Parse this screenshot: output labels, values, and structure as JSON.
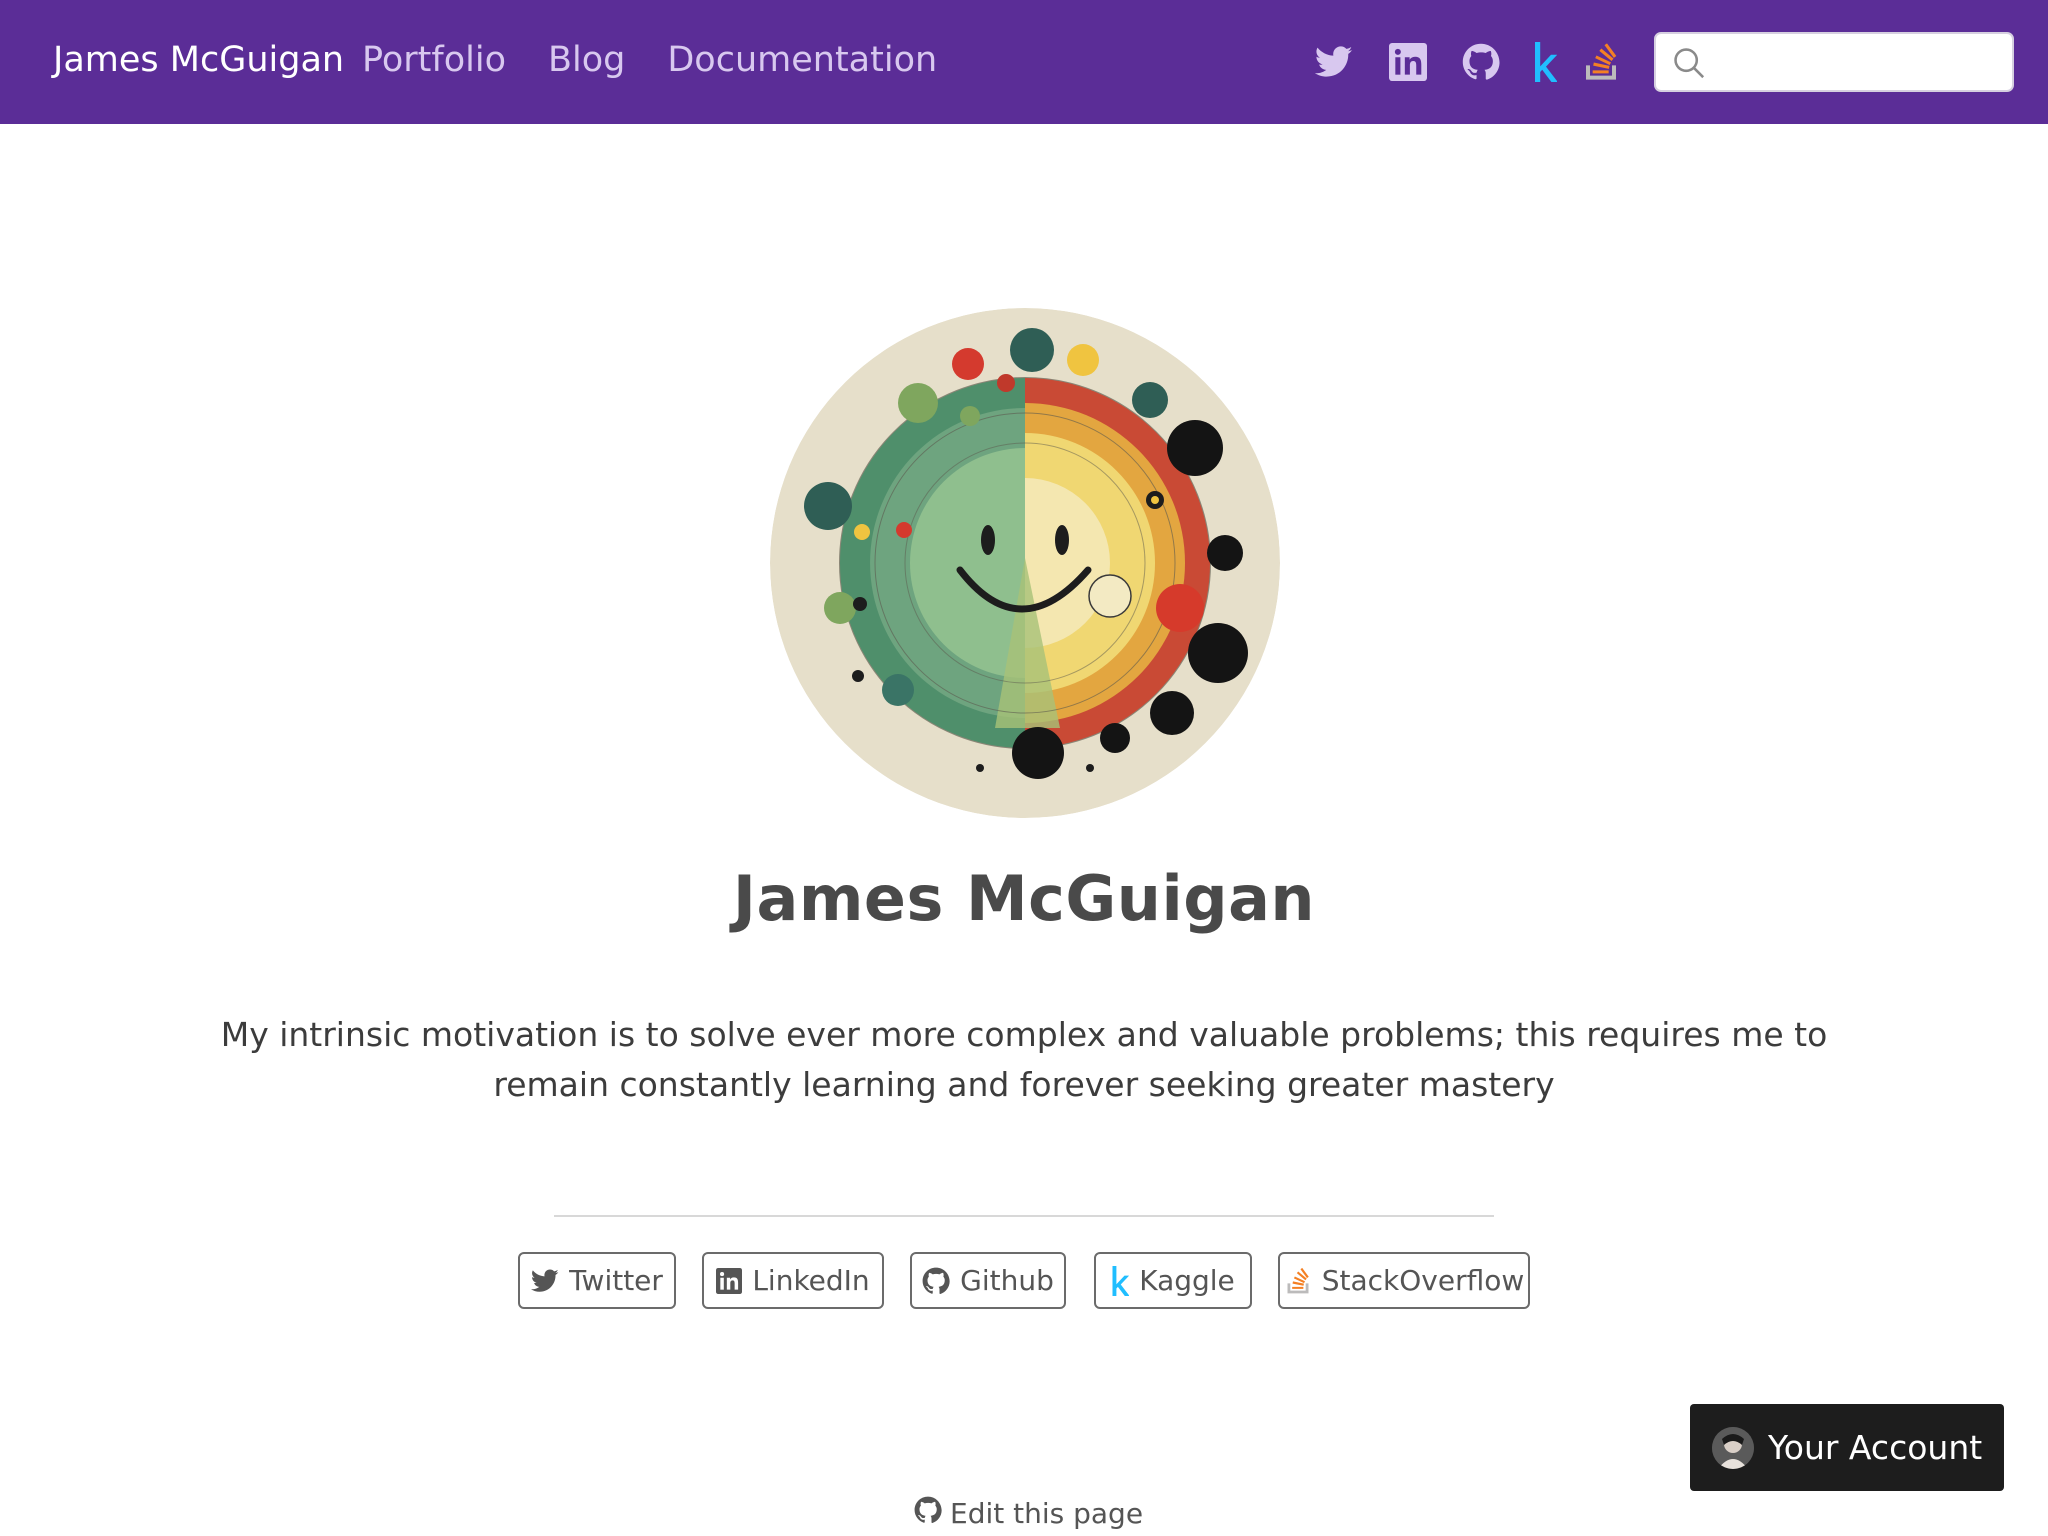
{
  "navbar": {
    "brand": "James McGuigan",
    "links": [
      "Portfolio",
      "Blog",
      "Documentation"
    ],
    "social_icons": [
      "twitter-icon",
      "linkedin-icon",
      "github-icon",
      "kaggle-icon",
      "stackoverflow-icon"
    ],
    "search": {
      "value": "",
      "placeholder": ""
    },
    "colors": {
      "background": "#5b2d97",
      "link": "#d8c8ef",
      "brand": "#ffffff",
      "kaggle": "#20beff",
      "stackoverflow": "#f48024"
    }
  },
  "profile": {
    "name": "James McGuigan",
    "tagline_line1": "My intrinsic motivation is to solve ever more complex and valuable problems; this requires me to",
    "tagline_line2": "remain constantly learning and forever seeking greater mastery"
  },
  "social_buttons": [
    {
      "label": "Twitter",
      "icon": "twitter-icon"
    },
    {
      "label": "LinkedIn",
      "icon": "linkedin-icon"
    },
    {
      "label": "Github",
      "icon": "github-icon"
    },
    {
      "label": "Kaggle",
      "icon": "kaggle-icon"
    },
    {
      "label": "StackOverflow",
      "icon": "stackoverflow-icon"
    }
  ],
  "account_button": {
    "label": "Your Account"
  },
  "footer": {
    "edit_link": "Edit this page"
  }
}
